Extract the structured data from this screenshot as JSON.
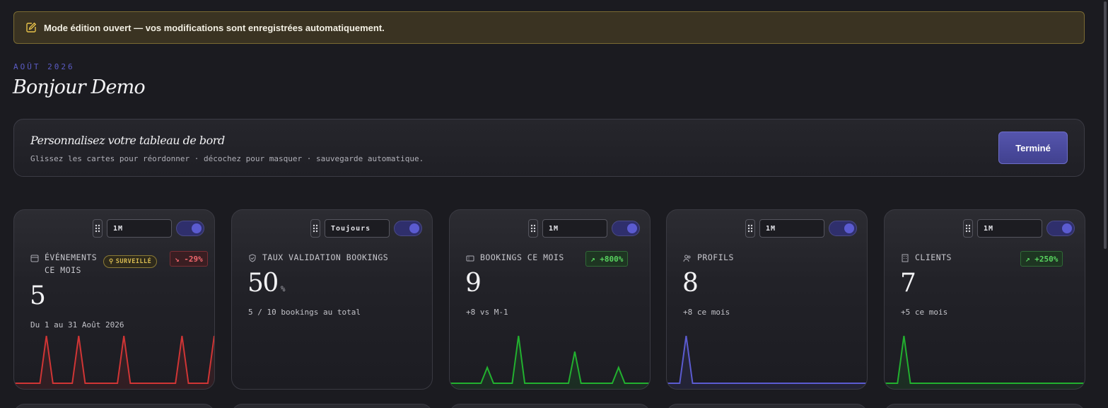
{
  "banner": {
    "text": "Mode édition ouvert — vos modifications sont enregistrées automatiquement.",
    "icon": "edit-icon"
  },
  "header": {
    "date": "AOÛT 2026",
    "greeting": "Bonjour Demo"
  },
  "customize": {
    "title": "Personnalisez votre tableau de bord",
    "subtitle": "Glissez les cartes pour réordonner · décochez pour masquer · sauvegarde automatique.",
    "done_label": "Terminé"
  },
  "colors": {
    "accent": "#4c4ca6",
    "up": "#22b02f",
    "down": "#d03535",
    "purple": "#5b5bd0",
    "warning": "#d8bb52"
  },
  "cards": [
    {
      "period": "1M",
      "icon": "calendar-icon",
      "title": "ÉVÉNEMENTS CE MOIS",
      "watch": "SURVEILLÉ",
      "badge": "↘ -29%",
      "value": "5",
      "note": "Du 1 au 31 Août 2026",
      "enabled": true,
      "spark": [
        0,
        0,
        0,
        0,
        0,
        1,
        0,
        0,
        0,
        0,
        1,
        0,
        0,
        0,
        0,
        0,
        0,
        1,
        0,
        0,
        0,
        0,
        0,
        0,
        0,
        0,
        1,
        0,
        0,
        0,
        0,
        1
      ]
    },
    {
      "period": "Toujours",
      "icon": "shield-icon",
      "title": "TAUX VALIDATION BOOKINGS",
      "value": "50",
      "unit": "%",
      "note": "5 / 10 bookings au total",
      "enabled": true
    },
    {
      "period": "1M",
      "icon": "ticket-icon",
      "title": "BOOKINGS CE MOIS",
      "badge": "↗ +800%",
      "value": "9",
      "note": "+8 vs M-1",
      "enabled": true,
      "spark": [
        0,
        0,
        0,
        0,
        0,
        0,
        1,
        0,
        0,
        0,
        0,
        3,
        0,
        0,
        0,
        0,
        0,
        0,
        0,
        0,
        2,
        0,
        0,
        0,
        0,
        0,
        0,
        1,
        0,
        0,
        0,
        0,
        0
      ]
    },
    {
      "period": "1M",
      "icon": "users-icon",
      "title": "PROFILS",
      "value": "8",
      "note": "+8 ce mois",
      "enabled": true,
      "spark": [
        0,
        0,
        0,
        8,
        0,
        0,
        0,
        0,
        0,
        0,
        0,
        0,
        0,
        0,
        0,
        0,
        0,
        0,
        0,
        0,
        0,
        0,
        0,
        0,
        0,
        0,
        0,
        0,
        0,
        0,
        0,
        0
      ]
    },
    {
      "period": "1M",
      "icon": "building-icon",
      "title": "CLIENTS",
      "badge": "↗ +250%",
      "value": "7",
      "note": "+5 ce mois",
      "enabled": true,
      "spark": [
        0,
        0,
        0,
        7,
        0,
        0,
        0,
        0,
        0,
        0,
        0,
        0,
        0,
        0,
        0,
        0,
        0,
        0,
        0,
        0,
        0,
        0,
        0,
        0,
        0,
        0,
        0,
        0,
        0,
        0,
        0,
        0
      ]
    }
  ]
}
